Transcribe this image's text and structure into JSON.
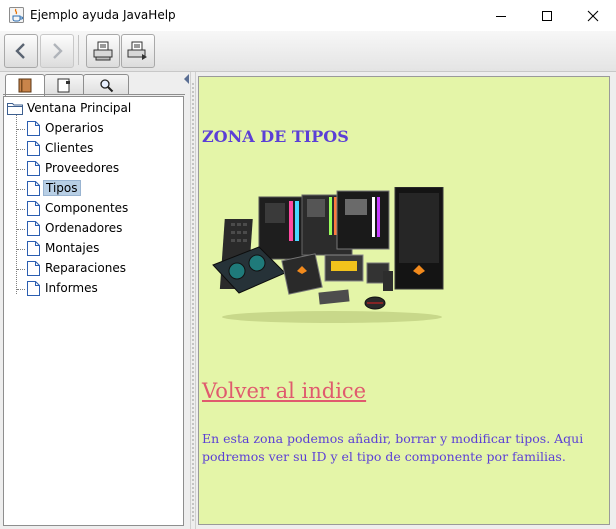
{
  "window": {
    "title": "Ejemplo ayuda JavaHelp"
  },
  "navigator": {
    "root": "Ventana Principal",
    "items": [
      {
        "label": "Operarios"
      },
      {
        "label": "Clientes"
      },
      {
        "label": "Proveedores"
      },
      {
        "label": "Tipos",
        "selected": true
      },
      {
        "label": "Componentes"
      },
      {
        "label": "Ordenadores"
      },
      {
        "label": "Montajes"
      },
      {
        "label": "Reparaciones"
      },
      {
        "label": "Informes"
      }
    ]
  },
  "content": {
    "heading": "ZONA DE TIPOS",
    "link": "Volver al indice",
    "description": "En esta zona podemos añadir, borrar y modificar tipos. Aqui podremos ver su ID y el tipo de componente por familias.",
    "background_color": "#e4f5a8",
    "text_color": "#5b3fd6",
    "link_color": "#e05a6e"
  }
}
